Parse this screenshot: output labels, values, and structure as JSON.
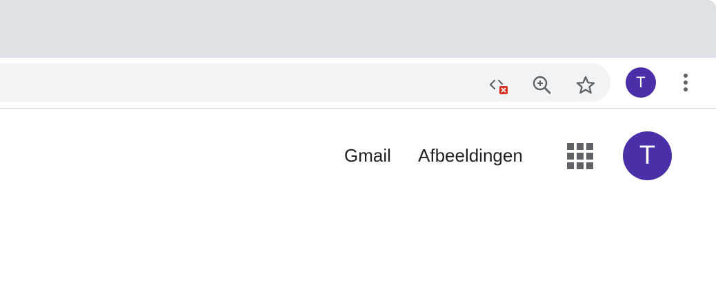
{
  "browser": {
    "toolbar": {
      "icons": [
        "code-blocked-icon",
        "zoom-icon",
        "bookmark-star-icon"
      ],
      "profile_initial": "T",
      "menu_icon": "more-vert-icon"
    }
  },
  "page": {
    "links": {
      "gmail": "Gmail",
      "images": "Afbeeldingen"
    },
    "apps_icon": "apps-grid-icon",
    "profile_initial": "T"
  },
  "colors": {
    "tabstrip_bg": "#dee1e6",
    "omnibox_bg": "#f1f3f4",
    "avatar_bg": "#4a2fa8",
    "blocked_badge": "#d93025",
    "icon_gray": "#5f6368"
  }
}
